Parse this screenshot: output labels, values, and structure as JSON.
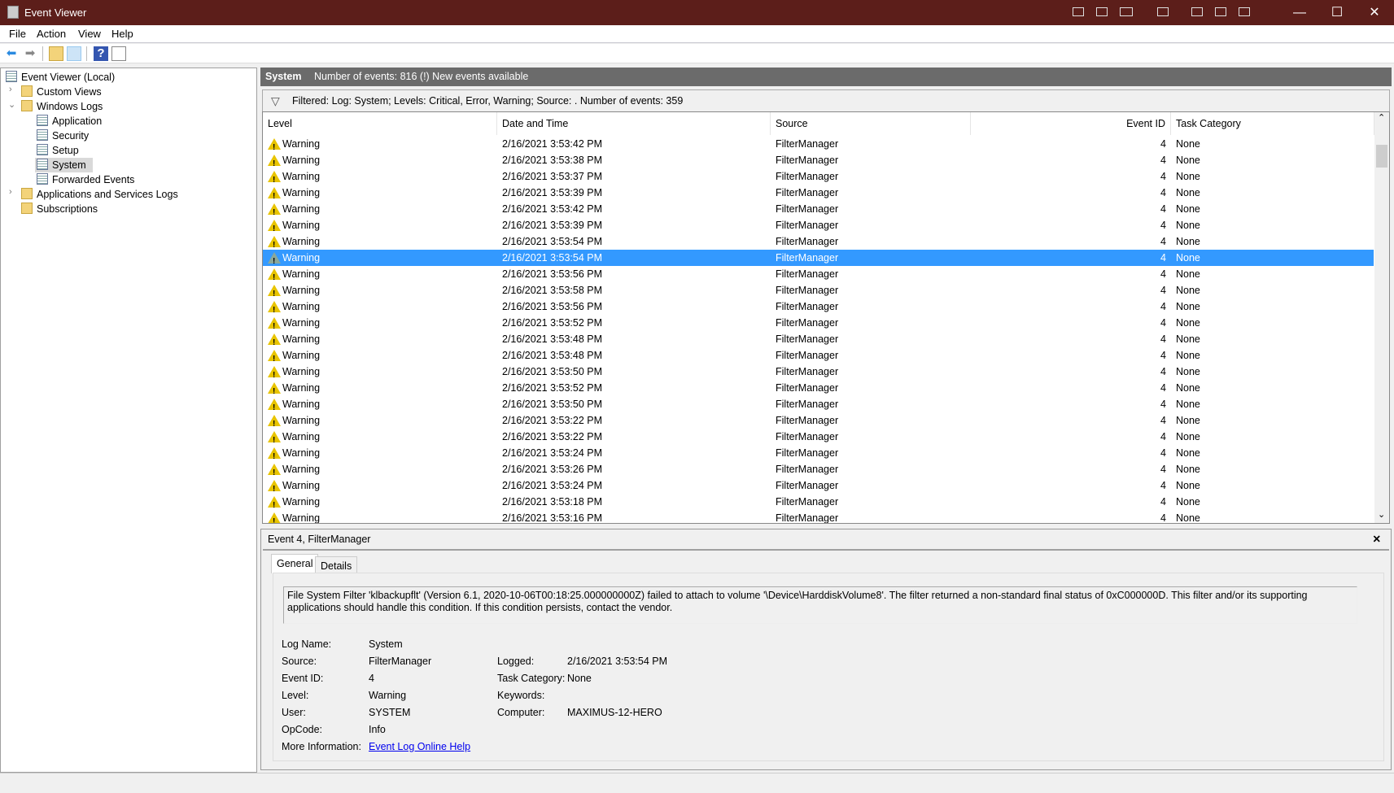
{
  "window": {
    "title": "Event Viewer",
    "minimize": "—",
    "maximize": "☐",
    "close": "✕"
  },
  "menu": [
    "File",
    "Action",
    "View",
    "Help"
  ],
  "toolbar": {
    "back": "back-icon",
    "forward": "forward-icon",
    "up": "folder-up-icon",
    "show_hide": "show-hide-tree-icon",
    "help": "help-icon",
    "action_pane": "action-pane-icon"
  },
  "tree": {
    "root": "Event Viewer (Local)",
    "custom_views": "Custom Views",
    "windows_logs": "Windows Logs",
    "application": "Application",
    "security": "Security",
    "setup": "Setup",
    "system": "System",
    "forwarded": "Forwarded Events",
    "app_services": "Applications and Services Logs",
    "subscriptions": "Subscriptions"
  },
  "header": {
    "log": "System",
    "info": "Number of events: 816 (!) New events available"
  },
  "filter": "Filtered: Log: System; Levels: Critical, Error, Warning; Source: . Number of events: 359",
  "columns": [
    "Level",
    "Date and Time",
    "Source",
    "Event ID",
    "Task Category"
  ],
  "rows": [
    {
      "level": "Warning",
      "date": "2/16/2021 3:53:42 PM",
      "source": "FilterManager",
      "id": "4",
      "cat": "None"
    },
    {
      "level": "Warning",
      "date": "2/16/2021 3:53:38 PM",
      "source": "FilterManager",
      "id": "4",
      "cat": "None"
    },
    {
      "level": "Warning",
      "date": "2/16/2021 3:53:37 PM",
      "source": "FilterManager",
      "id": "4",
      "cat": "None"
    },
    {
      "level": "Warning",
      "date": "2/16/2021 3:53:39 PM",
      "source": "FilterManager",
      "id": "4",
      "cat": "None"
    },
    {
      "level": "Warning",
      "date": "2/16/2021 3:53:42 PM",
      "source": "FilterManager",
      "id": "4",
      "cat": "None"
    },
    {
      "level": "Warning",
      "date": "2/16/2021 3:53:39 PM",
      "source": "FilterManager",
      "id": "4",
      "cat": "None"
    },
    {
      "level": "Warning",
      "date": "2/16/2021 3:53:54 PM",
      "source": "FilterManager",
      "id": "4",
      "cat": "None"
    },
    {
      "level": "Warning",
      "date": "2/16/2021 3:53:54 PM",
      "source": "FilterManager",
      "id": "4",
      "cat": "None",
      "selected": true
    },
    {
      "level": "Warning",
      "date": "2/16/2021 3:53:56 PM",
      "source": "FilterManager",
      "id": "4",
      "cat": "None"
    },
    {
      "level": "Warning",
      "date": "2/16/2021 3:53:58 PM",
      "source": "FilterManager",
      "id": "4",
      "cat": "None"
    },
    {
      "level": "Warning",
      "date": "2/16/2021 3:53:56 PM",
      "source": "FilterManager",
      "id": "4",
      "cat": "None"
    },
    {
      "level": "Warning",
      "date": "2/16/2021 3:53:52 PM",
      "source": "FilterManager",
      "id": "4",
      "cat": "None"
    },
    {
      "level": "Warning",
      "date": "2/16/2021 3:53:48 PM",
      "source": "FilterManager",
      "id": "4",
      "cat": "None"
    },
    {
      "level": "Warning",
      "date": "2/16/2021 3:53:48 PM",
      "source": "FilterManager",
      "id": "4",
      "cat": "None"
    },
    {
      "level": "Warning",
      "date": "2/16/2021 3:53:50 PM",
      "source": "FilterManager",
      "id": "4",
      "cat": "None"
    },
    {
      "level": "Warning",
      "date": "2/16/2021 3:53:52 PM",
      "source": "FilterManager",
      "id": "4",
      "cat": "None"
    },
    {
      "level": "Warning",
      "date": "2/16/2021 3:53:50 PM",
      "source": "FilterManager",
      "id": "4",
      "cat": "None"
    },
    {
      "level": "Warning",
      "date": "2/16/2021 3:53:22 PM",
      "source": "FilterManager",
      "id": "4",
      "cat": "None"
    },
    {
      "level": "Warning",
      "date": "2/16/2021 3:53:22 PM",
      "source": "FilterManager",
      "id": "4",
      "cat": "None"
    },
    {
      "level": "Warning",
      "date": "2/16/2021 3:53:24 PM",
      "source": "FilterManager",
      "id": "4",
      "cat": "None"
    },
    {
      "level": "Warning",
      "date": "2/16/2021 3:53:26 PM",
      "source": "FilterManager",
      "id": "4",
      "cat": "None"
    },
    {
      "level": "Warning",
      "date": "2/16/2021 3:53:24 PM",
      "source": "FilterManager",
      "id": "4",
      "cat": "None"
    },
    {
      "level": "Warning",
      "date": "2/16/2021 3:53:18 PM",
      "source": "FilterManager",
      "id": "4",
      "cat": "None"
    },
    {
      "level": "Warning",
      "date": "2/16/2021 3:53:16 PM",
      "source": "FilterManager",
      "id": "4",
      "cat": "None"
    }
  ],
  "preview": {
    "title": "Event 4, FilterManager",
    "close": "✕",
    "tabs": [
      "General",
      "Details"
    ],
    "message": "File System Filter 'klbackupflt' (Version 6.1, 2020-10-06T00:18:25.000000000Z) failed to attach to volume '\\Device\\HarddiskVolume8'.  The filter returned a non-standard final status of 0xC000000D.  This filter and/or its supporting applications should handle this condition.  If this condition persists, contact the vendor.",
    "labels": {
      "log_name": "Log Name:",
      "source": "Source:",
      "event_id": "Event ID:",
      "level": "Level:",
      "user": "User:",
      "opcode": "OpCode:",
      "more_info": "More Information:",
      "logged": "Logged:",
      "task_category": "Task Category:",
      "keywords": "Keywords:",
      "computer": "Computer:"
    },
    "values": {
      "log_name": "System",
      "source": "FilterManager",
      "event_id": "4",
      "level": "Warning",
      "user": "SYSTEM",
      "opcode": "Info",
      "more_info": "Event Log Online Help",
      "logged": "2/16/2021 3:53:54 PM",
      "task_category": "None",
      "keywords": "",
      "computer": "MAXIMUS-12-HERO"
    }
  }
}
